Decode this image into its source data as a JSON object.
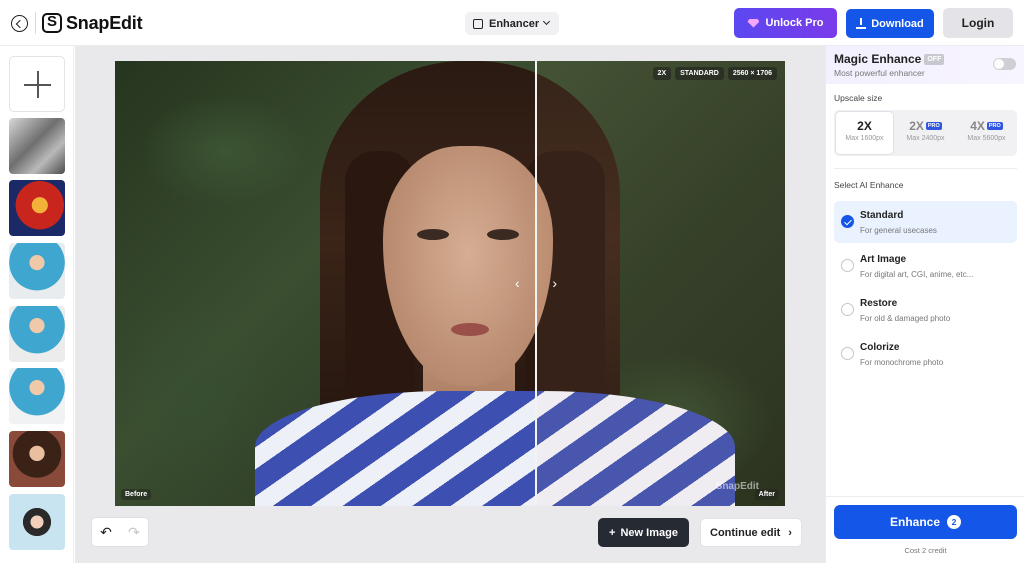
{
  "header": {
    "logo_text": "SnapEdit",
    "mode": "Enhancer",
    "unlock_label": "Unlock Pro",
    "download_label": "Download",
    "login_label": "Login"
  },
  "canvas": {
    "scale_badge": "2X",
    "model_badge": "STANDARD",
    "resolution_badge": "2560 × 1706",
    "before_label": "Before",
    "after_label": "After",
    "watermark": "SnapEdit"
  },
  "actions": {
    "undo_icon": "↶",
    "redo_icon": "↷",
    "new_image_label": "New Image",
    "continue_label": "Continue edit"
  },
  "panel": {
    "magic_title": "Magic Enhance",
    "magic_badge": "OFF",
    "magic_sub": "Most powerful enhancer",
    "upscale_title": "Upscale size",
    "sizes": [
      {
        "label": "2X",
        "pro": "",
        "max": "Max 1600px"
      },
      {
        "label": "2X",
        "pro": "PRO",
        "max": "Max 2400px"
      },
      {
        "label": "4X",
        "pro": "PRO",
        "max": "Max 5600px"
      }
    ],
    "select_title": "Select AI Enhance",
    "options": [
      {
        "name": "Standard",
        "desc": "For general usecases"
      },
      {
        "name": "Art Image",
        "desc": "For digital art, CGI, anime, etc..."
      },
      {
        "name": "Restore",
        "desc": "For old & damaged photo"
      },
      {
        "name": "Colorize",
        "desc": "For monochrome photo"
      }
    ],
    "enhance_label": "Enhance",
    "enhance_count": "2",
    "cost_label": "Cost 2 credit"
  },
  "colors": {
    "accent": "#1356e8",
    "pro": "#5b48f0"
  }
}
